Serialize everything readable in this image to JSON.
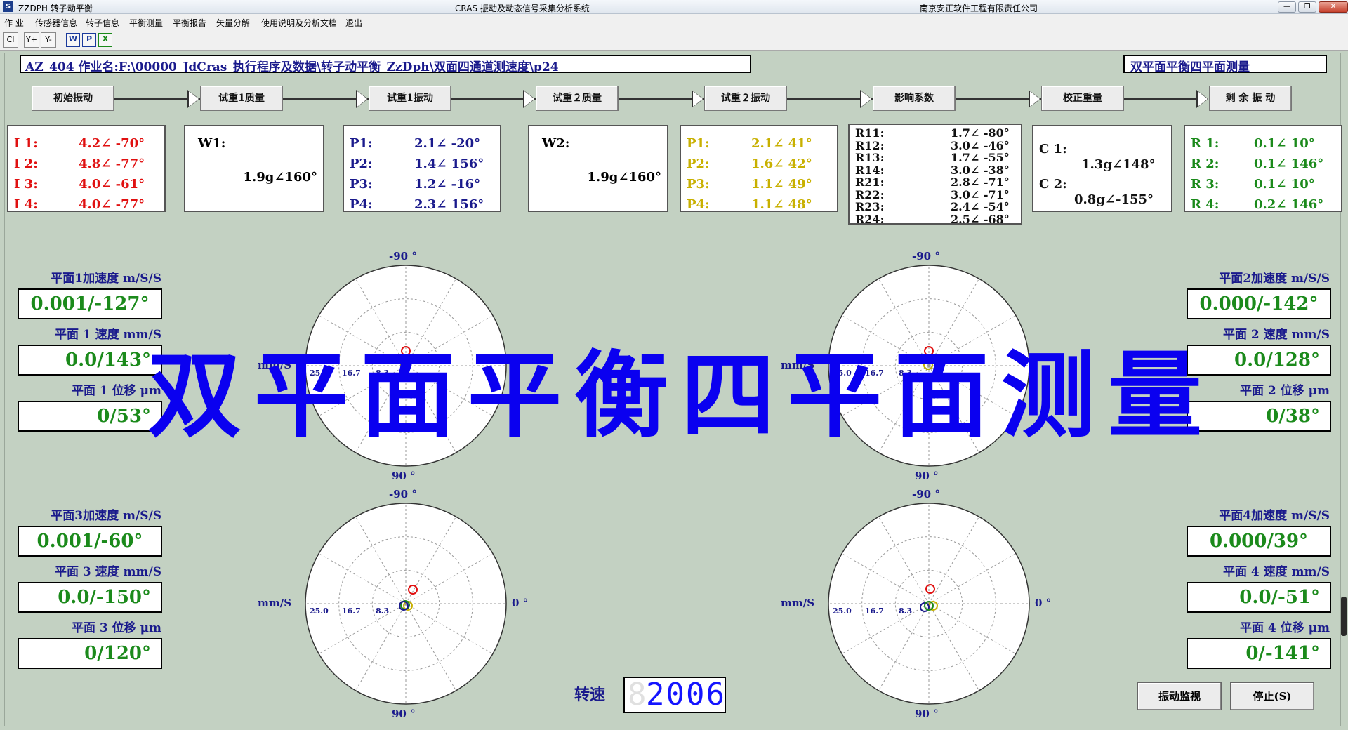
{
  "window": {
    "app_title": "ZZDPH 转子动平衡",
    "center_title": "CRAS 振动及动态信号采集分析系统",
    "company": "南京安正软件工程有限责任公司",
    "icon_text": "S",
    "minimize": "—",
    "restore": "❐",
    "close": "✕"
  },
  "menu": [
    "作 业",
    "传感器信息",
    "转子信息",
    "平衡测量",
    "平衡报告",
    "矢量分解",
    "使用说明及分析文档",
    "退出"
  ],
  "toolbar": {
    "ci": "CI",
    "y_plus": "Y+",
    "y_minus": "Y-",
    "w": "W",
    "p": "P",
    "x": "X"
  },
  "job_path": "AZ_404 作业名:F:\\00000_JdCras_执行程序及数据\\转子动平衡_ZzDph\\双面四通道测速度\\p24",
  "mode_label": "双平面平衡四平面测量",
  "steps": [
    "初始振动",
    "试重1质量",
    "试重1振动",
    "试重２质量",
    "试重２振动",
    "影响系数",
    "校正重量",
    "剩 余 振 动"
  ],
  "initial": [
    {
      "label": "I 1:",
      "value": "4.2∠ -70°"
    },
    {
      "label": "I 2:",
      "value": "4.8∠ -77°"
    },
    {
      "label": "I 3:",
      "value": "4.0∠ -61°"
    },
    {
      "label": "I 4:",
      "value": "4.0∠ -77°"
    }
  ],
  "w1": {
    "label": "W1:",
    "value": "1.9g∠160°"
  },
  "trial1": [
    {
      "label": "P1:",
      "value": "2.1∠ -20°"
    },
    {
      "label": "P2:",
      "value": "1.4∠ 156°"
    },
    {
      "label": "P3:",
      "value": "1.2∠ -16°"
    },
    {
      "label": "P4:",
      "value": "2.3∠ 156°"
    }
  ],
  "w2": {
    "label": "W2:",
    "value": "1.9g∠160°"
  },
  "trial2": [
    {
      "label": "P1:",
      "value": "2.1∠ 41°"
    },
    {
      "label": "P2:",
      "value": "1.6∠ 42°"
    },
    {
      "label": "P3:",
      "value": "1.1∠ 49°"
    },
    {
      "label": "P4:",
      "value": "1.1∠ 48°"
    }
  ],
  "influence": [
    {
      "label": "R11:",
      "value": "1.7∠ -80°"
    },
    {
      "label": "R12:",
      "value": "3.0∠ -46°"
    },
    {
      "label": "R13:",
      "value": "1.7∠ -55°"
    },
    {
      "label": "R14:",
      "value": "3.0∠ -38°"
    },
    {
      "label": "R21:",
      "value": "2.8∠ -71°"
    },
    {
      "label": "R22:",
      "value": "3.0∠ -71°"
    },
    {
      "label": "R23:",
      "value": "2.4∠ -54°"
    },
    {
      "label": "R24:",
      "value": "2.5∠ -68°"
    }
  ],
  "correction": [
    {
      "label": "C 1:",
      "value": "1.3g∠148°"
    },
    {
      "label": "C 2:",
      "value": "0.8g∠-155°"
    }
  ],
  "residual": [
    {
      "label": "R 1:",
      "value": "0.1∠ 10°"
    },
    {
      "label": "R 2:",
      "value": "0.1∠ 146°"
    },
    {
      "label": "R 3:",
      "value": "0.1∠ 10°"
    },
    {
      "label": "R 4:",
      "value": "0.2∠ 146°"
    }
  ],
  "planes": [
    {
      "acc_title": "平面1加速度 m/S/S",
      "acc": "0.001/-127°",
      "vel_title": "平面 1 速度 mm/S",
      "vel": "0.0/143°",
      "disp_title": "平面 1 位移 μm",
      "disp": "0/53°"
    },
    {
      "acc_title": "平面2加速度 m/S/S",
      "acc": "0.000/-142°",
      "vel_title": "平面 2 速度 mm/S",
      "vel": "0.0/128°",
      "disp_title": "平面 2 位移 μm",
      "disp": "0/38°"
    },
    {
      "acc_title": "平面3加速度 m/S/S",
      "acc": "0.001/-60°",
      "vel_title": "平面 3 速度 mm/S",
      "vel": "0.0/-150°",
      "disp_title": "平面 3 位移 μm",
      "disp": "0/120°"
    },
    {
      "acc_title": "平面4加速度 m/S/S",
      "acc": "0.000/39°",
      "vel_title": "平面 4 速度 mm/S",
      "vel": "0.0/-51°",
      "disp_title": "平面 4 位移 μm",
      "disp": "0/-141°"
    }
  ],
  "polar": {
    "top": "-90 °",
    "bottom": "90 °",
    "right": "0 °",
    "unit": "mm/S",
    "rings": [
      "25.0",
      "16.7",
      "8.3"
    ]
  },
  "overlay_text": "双平面平衡四平面测量",
  "speed": {
    "label": "转速",
    "value": "2006",
    "ghost": "8"
  },
  "buttons": {
    "monitor": "振动监视",
    "stop": "停止(S)"
  },
  "colors": {
    "red": "#e01010",
    "blue": "#1a1a8c",
    "green": "#1b8a1b",
    "yellow": "#c8b000",
    "black": "#111111",
    "overlay": "#0a00f0"
  }
}
